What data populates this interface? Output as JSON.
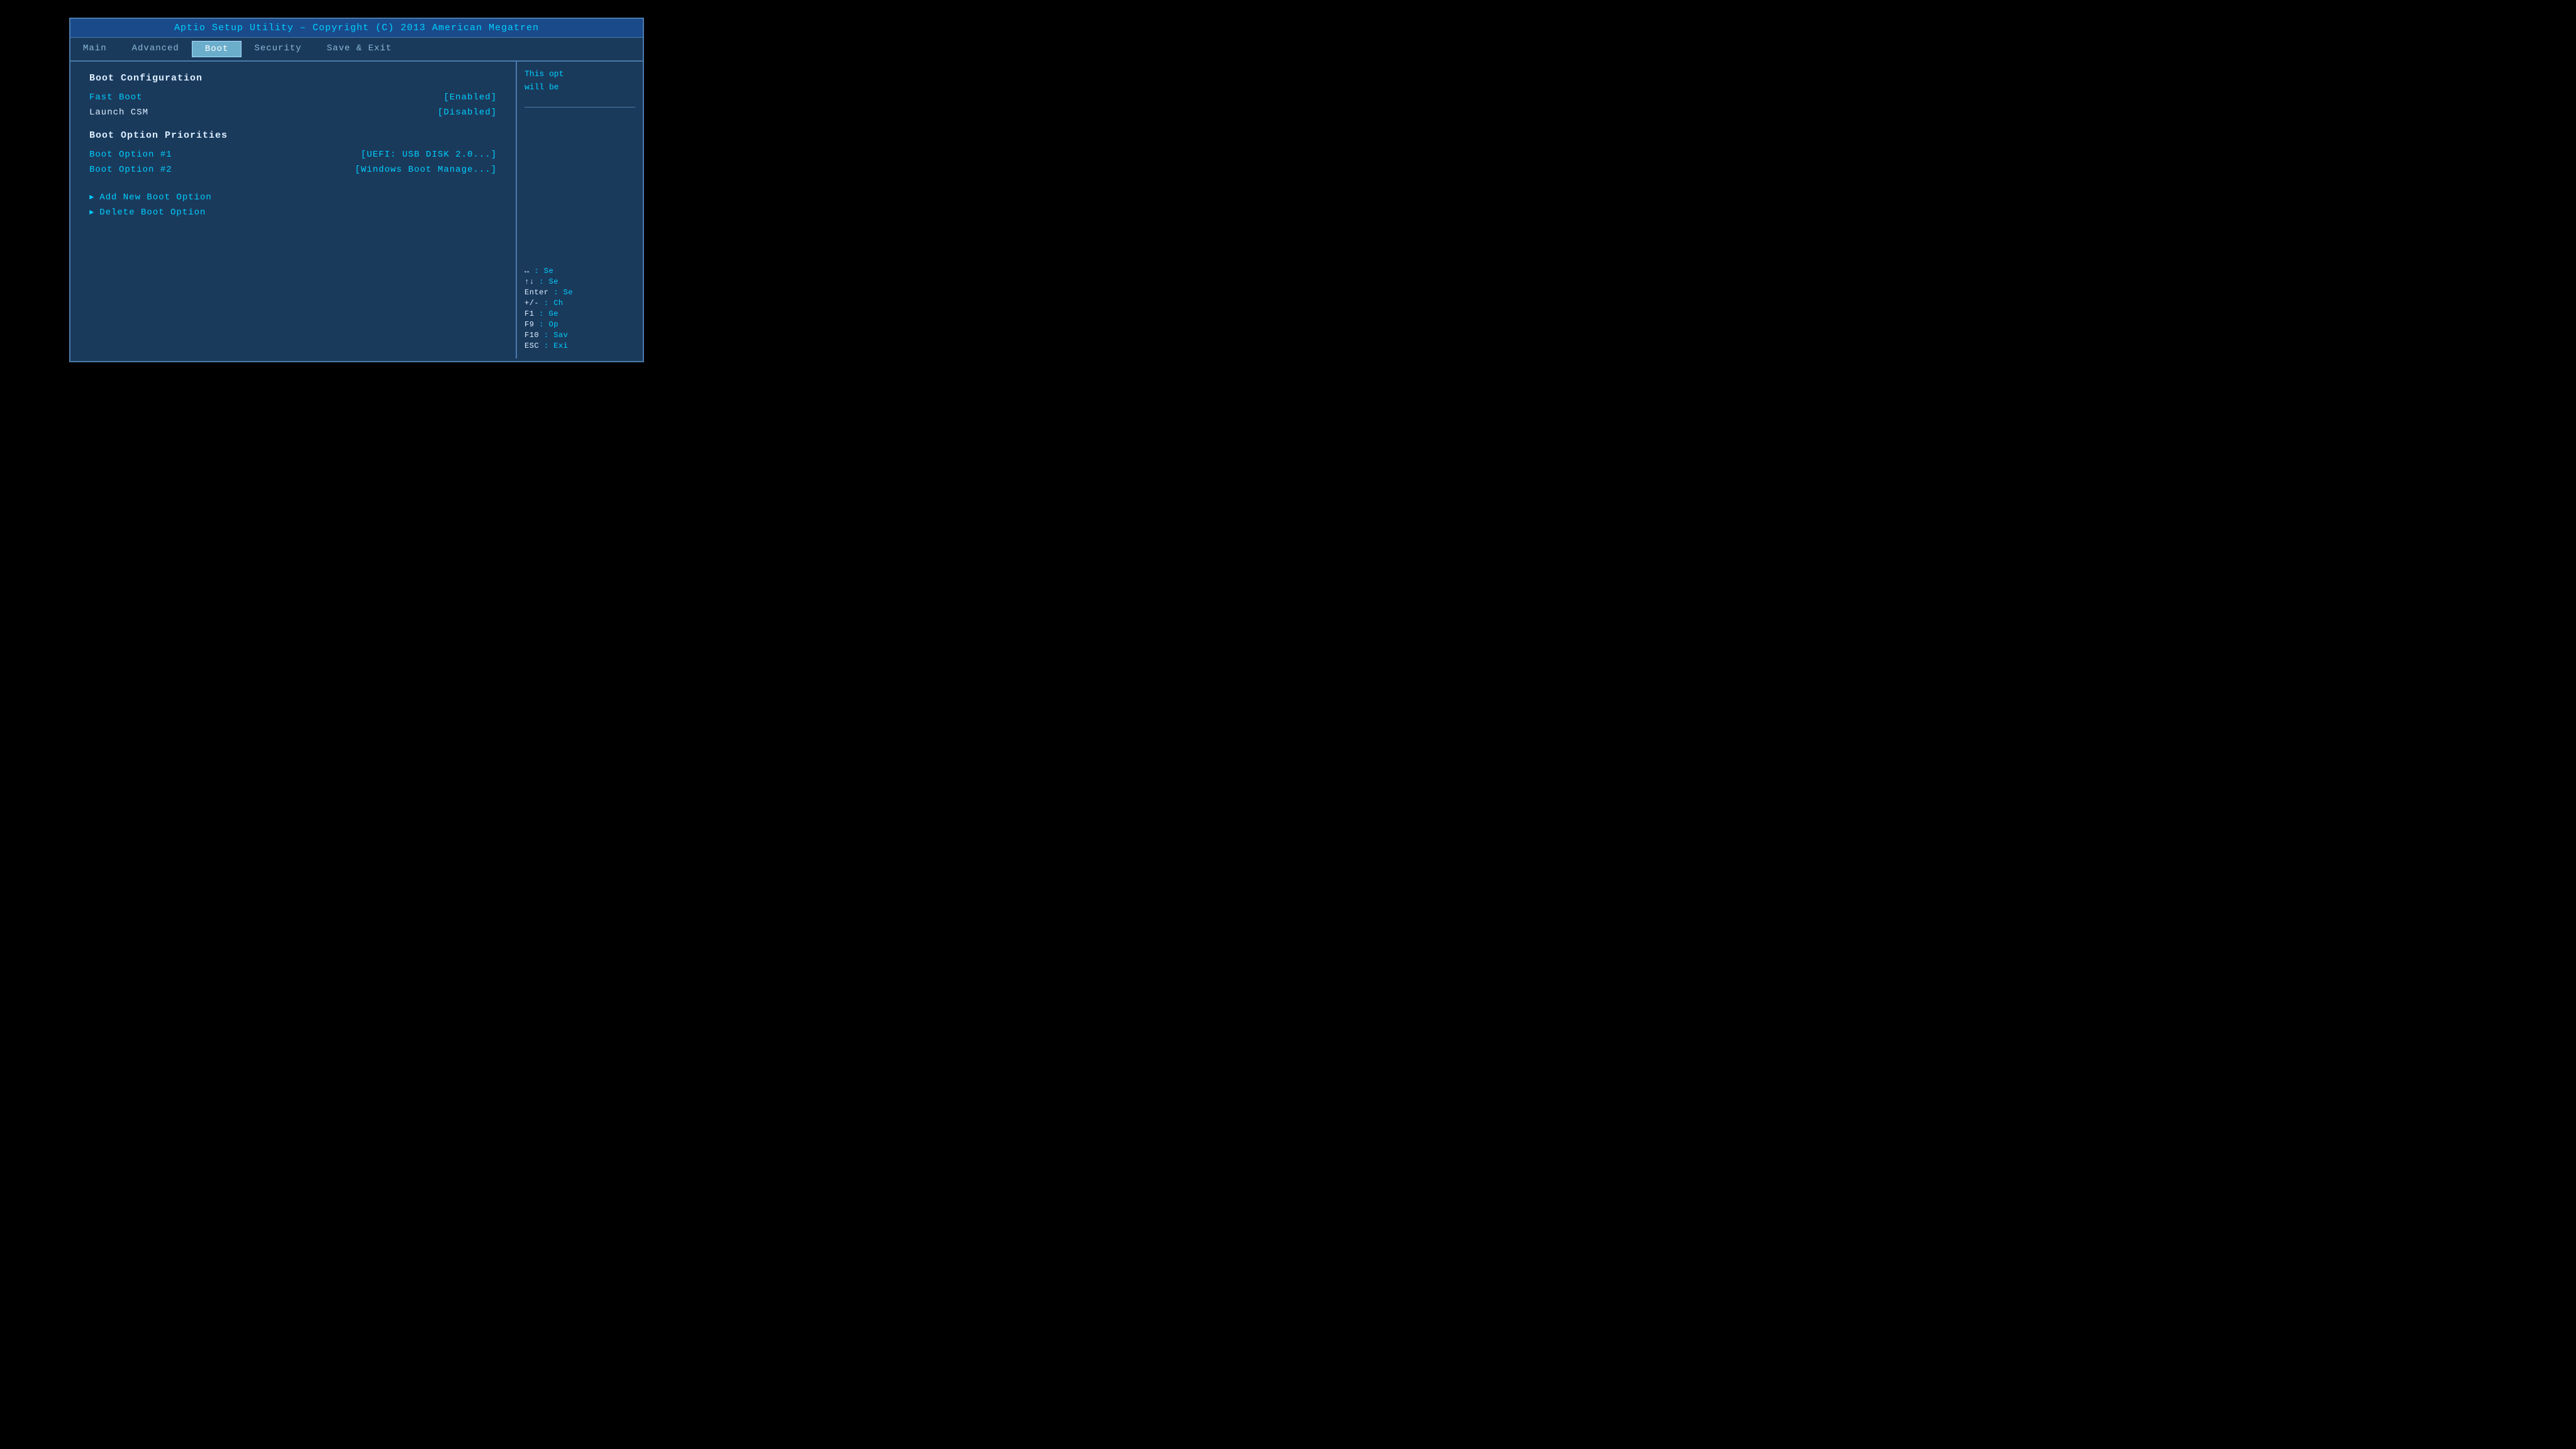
{
  "title_bar": {
    "text": "Aptio Setup Utility – Copyright (C) 2013 American Megatren"
  },
  "menu": {
    "items": [
      {
        "label": "Main",
        "active": false
      },
      {
        "label": "Advanced",
        "active": false
      },
      {
        "label": "Boot",
        "active": true
      },
      {
        "label": "Security",
        "active": false
      },
      {
        "label": "Save & Exit",
        "active": false
      }
    ]
  },
  "main": {
    "boot_config_title": "Boot Configuration",
    "fast_boot_label": "Fast Boot",
    "fast_boot_value": "[Enabled]",
    "launch_csm_label": "Launch CSM",
    "launch_csm_value": "[Disabled]",
    "boot_priority_title": "Boot Option Priorities",
    "boot_option1_label": "Boot Option #1",
    "boot_option1_value": "[UEFI:  USB DISK 2.0...]",
    "boot_option2_label": "Boot Option #2",
    "boot_option2_value": "[Windows Boot Manage...]",
    "add_new_boot_label": "Add New Boot Option",
    "delete_boot_label": "Delete Boot Option"
  },
  "side_panel": {
    "help_text_1": "This opt",
    "help_text_2": "will be",
    "key_hints": [
      {
        "key": "↔",
        "desc": ": Se"
      },
      {
        "key": "↑↓",
        "desc": ": Se"
      },
      {
        "key": "Enter",
        "desc": ": Se"
      },
      {
        "key": "+/-",
        "desc": ": Ch"
      },
      {
        "key": "F1",
        "desc": ": Ge"
      },
      {
        "key": "F9",
        "desc": ": Op"
      },
      {
        "key": "F10",
        "desc": ": Sav"
      },
      {
        "key": "ESC",
        "desc": ": Exi"
      }
    ]
  }
}
